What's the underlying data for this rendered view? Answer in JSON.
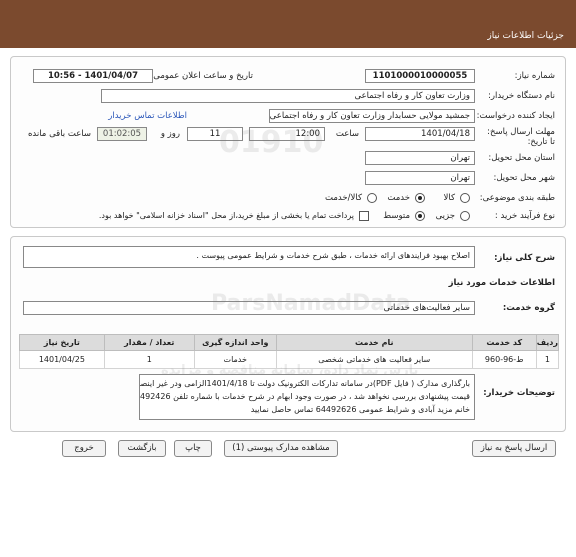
{
  "header": {
    "title": "جزئیات اطلاعات نیاز"
  },
  "fields": {
    "need_number_label": "شماره نیاز:",
    "need_number_value": "1101000010000055",
    "announce_label": "تاریخ و ساعت اعلان عمومی:",
    "announce_value": "1401/04/07 - 10:56",
    "buyer_org_label": "نام دستگاه خریدار:",
    "buyer_org_value": "وزارت تعاون کار و رفاه اجتماعی",
    "requester_label": "ایجاد کننده درخواست:",
    "requester_value": "جمشید مولایی حسابدار وزارت تعاون کار و رفاه اجتماعی",
    "contact_link": "اطلاعات تماس خریدار",
    "deadline_label": "مهلت ارسال پاسخ: تا تاریخ:",
    "deadline_date": "1401/04/18",
    "time_label": "ساعت",
    "deadline_time": "12:00",
    "days_value": "11",
    "days_label": "روز و",
    "remaining_value": "01:02:05",
    "remaining_label": "ساعت باقی مانده",
    "province_label": "استان محل تحویل:",
    "province_value": "تهران",
    "city_label": "شهر محل تحویل:",
    "city_value": "تهران",
    "category_label": "طبقه بندی موضوعی:",
    "category_options": [
      "کالا",
      "خدمت",
      "کالا/خدمت"
    ],
    "category_selected": 1,
    "process_label": "نوع فرآیند خرید :",
    "process_options": [
      "جزیی",
      "متوسط"
    ],
    "process_selected": 1,
    "payment_note": "پرداخت تمام یا بخشی از مبلغ خرید،از محل \"اسناد خزانه اسلامی\" خواهد بود."
  },
  "description": {
    "label": "شرح کلی نیاز:",
    "value": "اصلاح بهبود فرایندهای ارائه خدمات ، طبق شرح خدمات و شرایط عمومی پیوست ."
  },
  "services": {
    "section_title": "اطلاعات خدمات مورد نیاز",
    "group_label": "گروه خدمت:",
    "group_value": "سایر فعالیت‌های خدماتی",
    "columns": [
      "ردیف",
      "کد خدمت",
      "نام خدمت",
      "واحد اندازه گیری",
      "تعداد / مقدار",
      "تاریخ نیاز"
    ],
    "rows": [
      [
        "1",
        "ط-96-960",
        "سایر فعالیت های خدماتی شخصی",
        "خدمات",
        "1",
        "1401/04/25"
      ]
    ]
  },
  "buyer_notes": {
    "label": "توضیحات خریدار:",
    "lines": [
      "بارگذاری مدارک ( فایل PDF)در سامانه تدارکات الکترونیک دولت تا 1401/4/18الزامی ودر غیر اینصورت",
      "قیمت پیشنهادی بررسی نخواهد شد ، در صورت وجود ابهام در شرح خدمات با شماره تلفن 64492426",
      "خانم مزید آبادی و شرایط عمومی 64492626 تماس حاصل نمایید"
    ]
  },
  "buttons": {
    "reply": "ارسال پاسخ به نیاز",
    "attachments": "مشاهده مدارک پیوستی (1)",
    "print": "چاپ",
    "back": "بازگشت",
    "exit": "خروج"
  },
  "watermark": {
    "digits": "01910",
    "brand": "ParsNamadData",
    "tagline": "پارس نماد داده، سامانه مناقصه و مزایده"
  },
  "colors": {
    "header": "#7b4a2e",
    "link": "#2a56b8"
  }
}
